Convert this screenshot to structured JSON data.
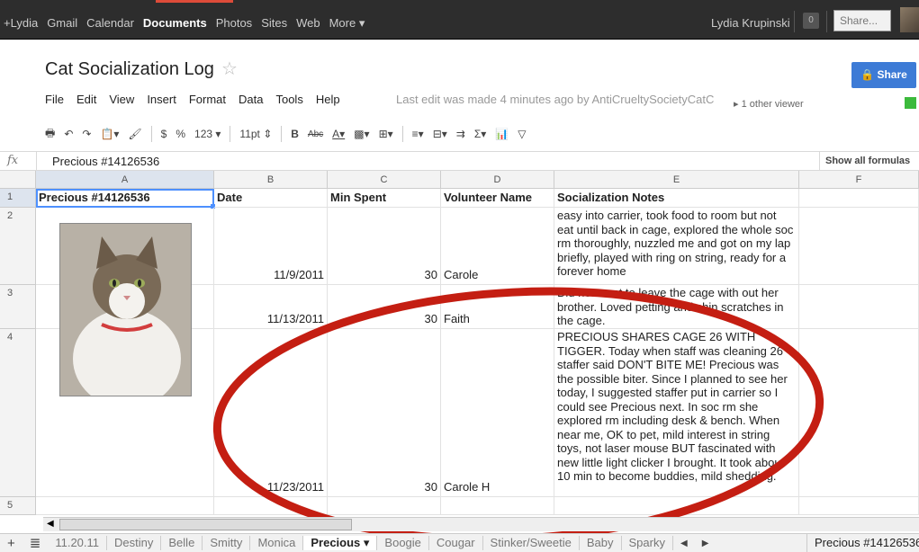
{
  "gbar": {
    "links": [
      "+Lydia",
      "Gmail",
      "Calendar",
      "Documents",
      "Photos",
      "Sites",
      "Web",
      "More ▾"
    ],
    "active_index": 3,
    "user": "Lydia Krupinski",
    "notif_count": "0",
    "share_label": "Share..."
  },
  "doc": {
    "title": "Cat Socialization Log",
    "share_button": "Share",
    "menu": [
      "File",
      "Edit",
      "View",
      "Insert",
      "Format",
      "Data",
      "Tools",
      "Help"
    ],
    "last_edit": "Last edit was made 4 minutes ago by AntiCrueltySocietyCatC",
    "viewers": "1 other viewer"
  },
  "toolbar": {
    "currency": "$",
    "percent": "%",
    "number_format": "123 ▾",
    "font_size": "11pt ⇕",
    "bold": "B"
  },
  "formula": {
    "fx": "fx",
    "value": "Precious #14126536",
    "show_formulas": "Show all formulas"
  },
  "sheet": {
    "columns": [
      "A",
      "B",
      "C",
      "D",
      "E",
      "F"
    ],
    "rows": [
      "1",
      "2",
      "3",
      "4",
      "5"
    ],
    "header": [
      "Precious #14126536",
      "Date",
      "Min Spent",
      "Volunteer Name",
      "Socialization Notes"
    ],
    "records": [
      {
        "date": "11/9/2011",
        "min": "30",
        "name": "Carole",
        "notes": "easy into carrier, took food to room but not eat until back in cage, explored the whole soc rm thoroughly, nuzzled me and got on my lap briefly, played with ring on string, ready for a forever home"
      },
      {
        "date": "11/13/2011",
        "min": "30",
        "name": "Faith",
        "notes": "Did not want to leave the cage with out her brother. Loved petting and chin scratches in the cage."
      },
      {
        "date": "11/23/2011",
        "min": "30",
        "name": "Carole H",
        "notes": "PRECIOUS SHARES CAGE 26 WITH TIGGER. Today when staff was cleaning 26 staffer said DON'T BITE ME! Precious was the possible biter. Since I planned to see her today, I suggested staffer put in carrier so I could see Precious next. In soc rm she explored rm including desk & bench. When near me, OK to pet, mild interest in string toys, not laser mouse BUT fascinated with new little light clicker I brought. It took about 10 min to become buddies, mild shedding."
      }
    ]
  },
  "tabs": {
    "items": [
      "11.20.11",
      "Destiny",
      "Belle",
      "Smitty",
      "Monica",
      "Precious ▾",
      "Boogie",
      "Cougar",
      "Stinker/Sweetie",
      "Baby",
      "Sparky"
    ],
    "active_index": 5,
    "current_sheet": "Precious #14126536"
  },
  "colors": {
    "accent": "#3d7bd6",
    "annotation": "#c41e12",
    "selection": "#4d90fe"
  }
}
